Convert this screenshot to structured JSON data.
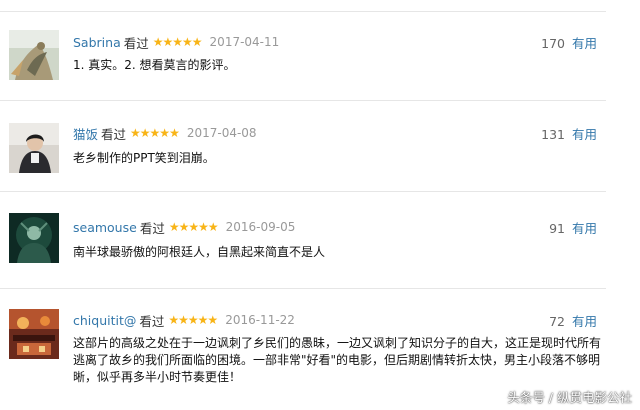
{
  "reviews": [
    {
      "username": "Sabrina",
      "seen_label": "看过",
      "stars": "★★★★★",
      "date": "2017-04-11",
      "votes": "170",
      "useful_label": "有用",
      "content": "1. 真实。2. 想看莫言的影评。"
    },
    {
      "username": "猫饭",
      "seen_label": "看过",
      "stars": "★★★★★",
      "date": "2017-04-08",
      "votes": "131",
      "useful_label": "有用",
      "content": "老乡制作的PPT笑到泪崩。"
    },
    {
      "username": "seamouse",
      "seen_label": "看过",
      "stars": "★★★★★",
      "date": "2016-09-05",
      "votes": "91",
      "useful_label": "有用",
      "content": "南半球最骄傲的阿根廷人，自黑起来简直不是人"
    },
    {
      "username": "chiquitit@",
      "seen_label": "看过",
      "stars": "★★★★★",
      "date": "2016-11-22",
      "votes": "72",
      "useful_label": "有用",
      "content": "这部片的高级之处在于一边讽刺了乡民们的愚昧，一边又讽刺了知识分子的自大，这正是现时代所有逃离了故乡的我们所面临的困境。一部非常\"好看\"的电影，但后期剧情转折太快，男主小段落不够明晰，似乎再多半小时节奏更佳！"
    }
  ],
  "watermark": "头条号 / 纵贯电影公社",
  "colors": {
    "link_blue": "#3377aa",
    "star_gold": "#f8b417",
    "date_gray": "#999999"
  }
}
